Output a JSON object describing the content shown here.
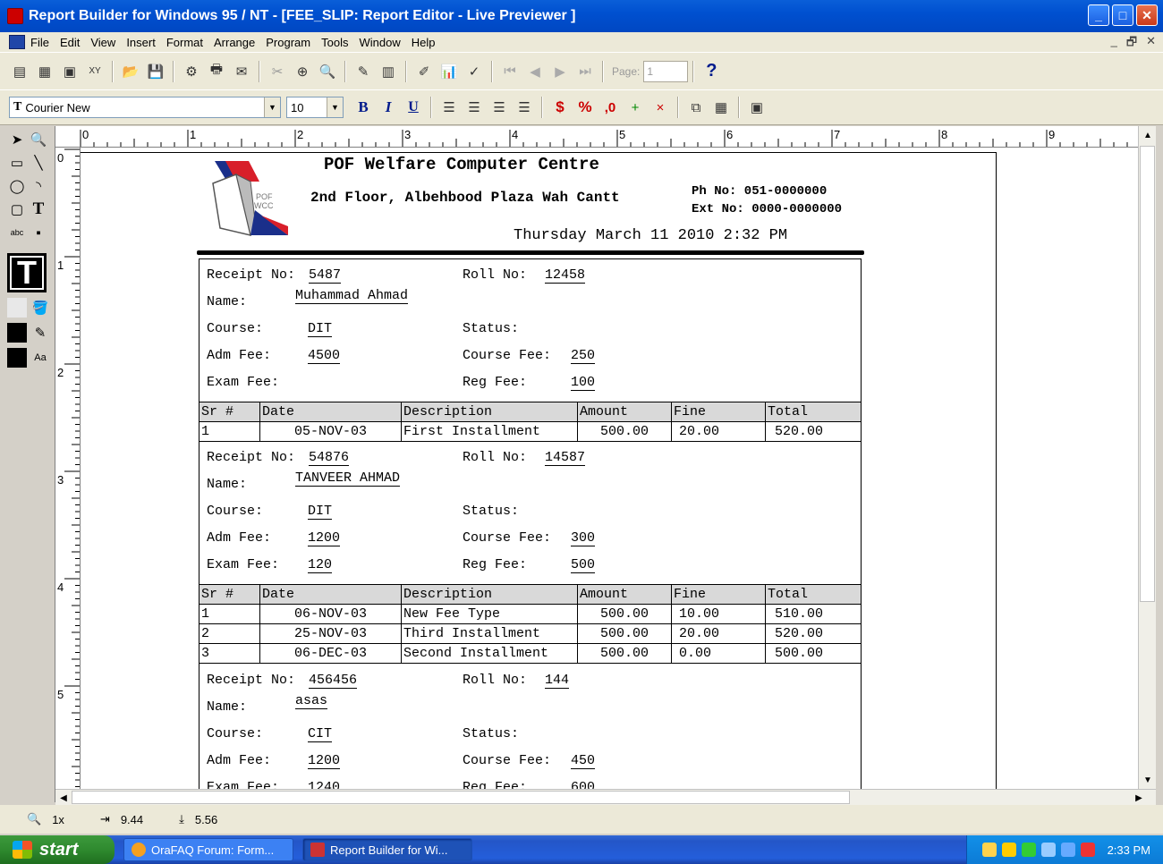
{
  "window": {
    "title": "Report Builder for Windows 95 / NT - [FEE_SLIP: Report Editor - Live Previewer ]",
    "min": "_",
    "max": "□",
    "close": "✕"
  },
  "menu": [
    "File",
    "Edit",
    "View",
    "Insert",
    "Format",
    "Arrange",
    "Program",
    "Tools",
    "Window",
    "Help"
  ],
  "mdi_buttons": [
    "_",
    "🗗",
    "✕"
  ],
  "toolbar": {
    "page_label": "Page:",
    "page_value": "1",
    "help": "?"
  },
  "format_bar": {
    "font": "Courier New",
    "size": "10",
    "bold": "B",
    "italic": "I",
    "underline": "U",
    "currency": "$",
    "percent": "%",
    "comma": ",0"
  },
  "ruler": {
    "h": [
      "0",
      "1",
      "2",
      "3",
      "4",
      "5",
      "6",
      "7",
      "8",
      "9"
    ],
    "v": [
      "0",
      "1",
      "2",
      "3",
      "4",
      "5"
    ]
  },
  "report": {
    "org_name": "POF Welfare Computer Centre",
    "address": "2nd Floor, Albehbood Plaza Wah Cantt",
    "phone": "Ph No: 051-0000000",
    "ext": "Ext No: 0000-0000000",
    "datetime": "Thursday March 11 2010 2:32 PM",
    "logo_text": [
      "POF",
      "WCC"
    ],
    "labels": {
      "receipt": "Receipt No:",
      "roll": "Roll No:",
      "name": "Name:",
      "course": "Course:",
      "status": "Status:",
      "adm_fee": "Adm Fee:",
      "course_fee": "Course Fee:",
      "exam_fee": "Exam Fee:",
      "reg_fee": "Reg Fee:"
    },
    "table_headers": [
      "Sr #",
      "Date",
      "Description",
      "Amount",
      "Fine",
      "Total"
    ],
    "receipts": [
      {
        "receipt_no": "5487",
        "roll_no": "12458",
        "name": "Muhammad Ahmad",
        "course": "DIT",
        "status": "",
        "adm_fee": "4500",
        "course_fee": "250",
        "exam_fee": "",
        "reg_fee": "100",
        "rows": [
          [
            "1",
            "05-NOV-03",
            "First Installment",
            "500.00",
            "20.00",
            "520.00"
          ]
        ]
      },
      {
        "receipt_no": "54876",
        "roll_no": "14587",
        "name": "TANVEER AHMAD",
        "course": "DIT",
        "status": "",
        "adm_fee": "1200",
        "course_fee": "300",
        "exam_fee": "120",
        "reg_fee": "500",
        "rows": [
          [
            "1",
            "06-NOV-03",
            "New Fee Type",
            "500.00",
            "10.00",
            "510.00"
          ],
          [
            "2",
            "25-NOV-03",
            "Third Installment",
            "500.00",
            "20.00",
            "520.00"
          ],
          [
            "3",
            "06-DEC-03",
            "Second Installment",
            "500.00",
            "0.00",
            "500.00"
          ]
        ]
      },
      {
        "receipt_no": "456456",
        "roll_no": "144",
        "name": "asas",
        "course": "CIT",
        "status": "",
        "adm_fee": "1200",
        "course_fee": "450",
        "exam_fee": "1240",
        "reg_fee": "600"
      }
    ]
  },
  "status": {
    "zoom": "1x",
    "x": "9.44",
    "y": "5.56"
  },
  "taskbar": {
    "start": "start",
    "tasks": [
      "OraFAQ Forum: Form...",
      "Report Builder for Wi..."
    ],
    "clock": "2:33 PM"
  }
}
